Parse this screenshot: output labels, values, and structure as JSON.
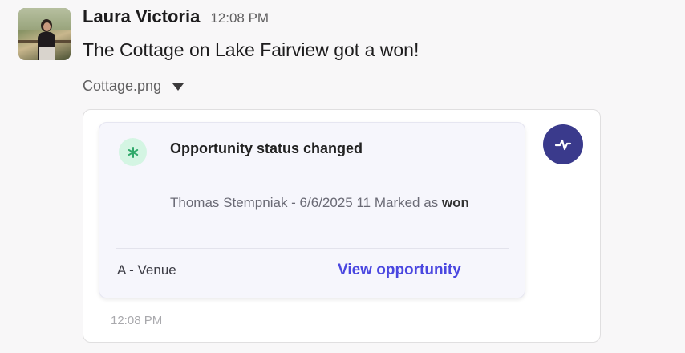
{
  "message": {
    "sender": "Laura Victoria",
    "time": "12:08 PM",
    "text": "The Cottage on Lake Fairview got a won!"
  },
  "file": {
    "name": "Cottage.png",
    "toggle_icon": "caret-down-icon"
  },
  "card": {
    "icon": "asterisk-icon",
    "title": "Opportunity status changed",
    "description_prefix": "Thomas Stempniak - 6/6/2025 11 Marked as ",
    "description_status": "won",
    "label": "A - Venue",
    "link": "View opportunity",
    "side_icon": "activity-icon",
    "timestamp": "12:08 PM"
  },
  "colors": {
    "link": "#4a47e0",
    "activity_button": "#3a3a8c",
    "card_icon_bg": "#d4f5e3",
    "card_icon_fg": "#2fa86a"
  }
}
